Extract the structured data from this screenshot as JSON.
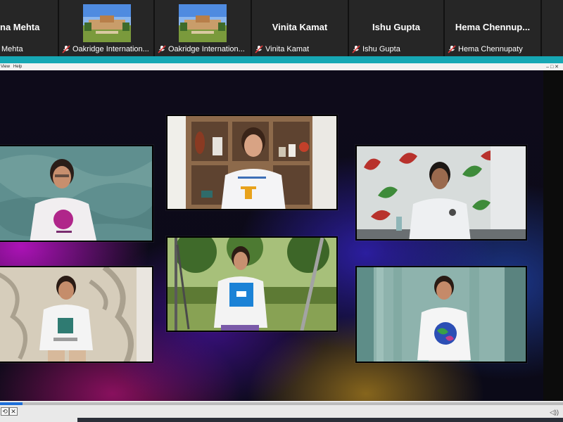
{
  "participants": [
    {
      "big_name": "na Mehta",
      "label": "Mehta",
      "has_mic_icon": false
    },
    {
      "big_name": "",
      "label": "Oakridge Internation...",
      "has_mic_icon": true
    },
    {
      "big_name": "",
      "label": "Oakridge Internation...",
      "has_mic_icon": true
    },
    {
      "big_name": "Vinita Kamat",
      "label": "Vinita Kamat",
      "has_mic_icon": true
    },
    {
      "big_name": "Ishu Gupta",
      "label": "Ishu Gupta",
      "has_mic_icon": true
    },
    {
      "big_name": "Hema  Chennup...",
      "label": "Hema Chennupaty",
      "has_mic_icon": true
    }
  ],
  "menu": {
    "items": [
      "View",
      "Help"
    ],
    "window_controls": "–  □  ✕"
  },
  "video_tiles": [
    {
      "name": "video-girl-teal-wall"
    },
    {
      "name": "video-girl-shelves"
    },
    {
      "name": "video-boy-leaf-wall"
    },
    {
      "name": "video-girl-curtain"
    },
    {
      "name": "video-girl-garden-swing"
    },
    {
      "name": "video-girl-blue-curtain"
    }
  ],
  "player": {
    "progress": 0.04,
    "volume_text": "◁))"
  },
  "colors": {
    "accent": "#16a7b4",
    "mic_muted": "#e03a3a"
  }
}
